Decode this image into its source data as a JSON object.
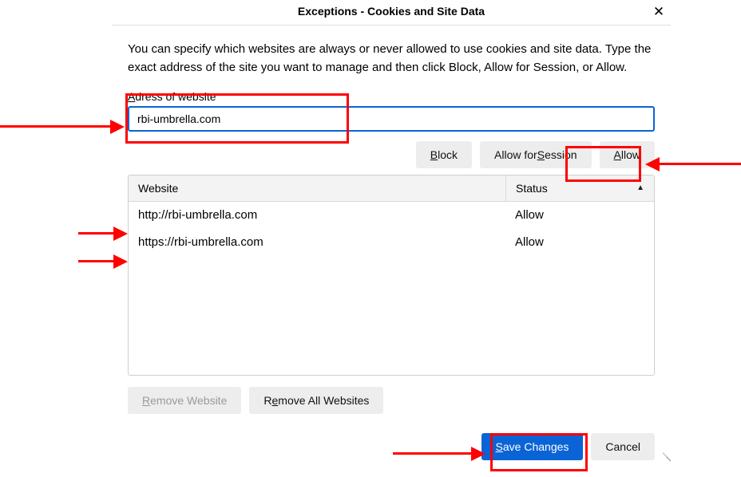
{
  "title": "Exceptions - Cookies and Site Data",
  "description": "You can specify which websites are always or never allowed to use cookies and site data. Type the exact address of the site you want to manage and then click Block, Allow for Session, or Allow.",
  "address_label_pre": "A",
  "address_label_post": "dress of website",
  "address_value": "rbi-umbrella.com",
  "buttons": {
    "block_pre": "",
    "block_u": "B",
    "block_post": "lock",
    "session_pre": "Allow for ",
    "session_u": "S",
    "session_post": "ession",
    "allow_pre": "",
    "allow_u": "A",
    "allow_post": "llow",
    "remove_pre": "",
    "remove_u": "R",
    "remove_post": "emove Website",
    "removeall_pre": "R",
    "removeall_u": "e",
    "removeall_post": "move All Websites",
    "save_pre": "",
    "save_u": "S",
    "save_post": "ave Changes",
    "cancel": "Cancel"
  },
  "columns": {
    "website": "Website",
    "status": "Status"
  },
  "rows": [
    {
      "site": "http://rbi-umbrella.com",
      "status": "Allow"
    },
    {
      "site": "https://rbi-umbrella.com",
      "status": "Allow"
    }
  ]
}
